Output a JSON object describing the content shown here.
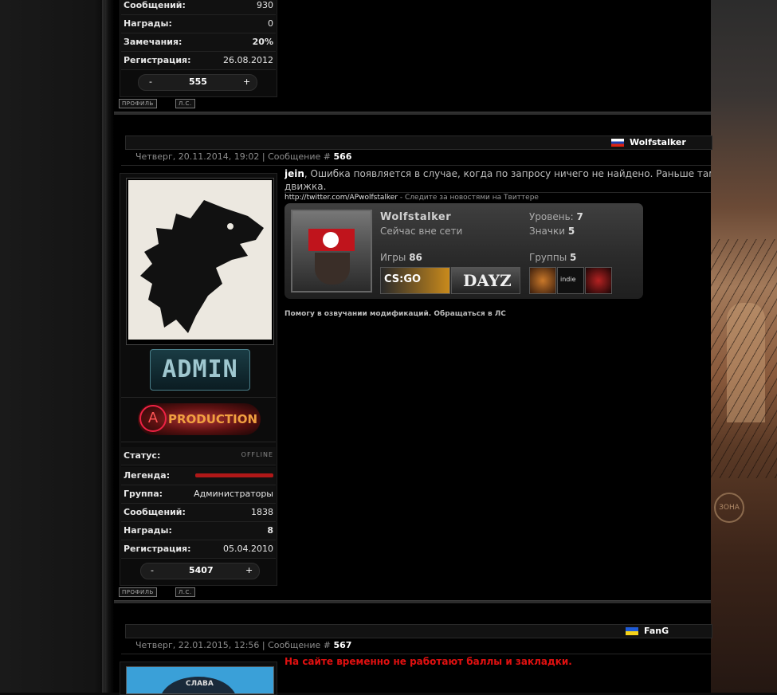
{
  "post_prev": {
    "stats": [
      {
        "label": "Сообщений:",
        "value": "930"
      },
      {
        "label": "Награды:",
        "value": "0"
      },
      {
        "label": "Замечания:",
        "value": "20%"
      },
      {
        "label": "Регистрация:",
        "value": "26.08.2012"
      }
    ],
    "rep": {
      "minus": "-",
      "value": "555",
      "plus": "+"
    },
    "btn_profile": "ПРОФИЛЬ",
    "btn_pm": "Л.С."
  },
  "post_566": {
    "author": "Wolfstalker",
    "date": "Четверг, 20.11.2014, 19:02 | Сообщение #",
    "number": "566",
    "reply_to": "jein",
    "message": ", Ошибка появляется в случае, когда по запросу ничего не найдено. Раньше там пи",
    "message_cont": "движка.",
    "twitter_link": "http://twitter.com/APwolfstalker",
    "twitter_text": " - Следите за новостями на Твиттере",
    "steam": {
      "name": "Wolfstalker",
      "status": "Сейчас вне сети",
      "level_label": "Уровень:",
      "level": "7",
      "badges_label": "Значки",
      "badges": "5",
      "games_label": "Игры",
      "games": "86",
      "groups_label": "Группы",
      "groups": "5",
      "game1": "CS:GO",
      "game2": "DAYZ",
      "group2": "indie"
    },
    "signature": "Помогу в озвучании модификаций. Обращаться в ЛС",
    "rank_badge": "ADMIN",
    "production_badge": "PRODUCTION",
    "stats": [
      {
        "label": "Статус:",
        "value": "OFFLINE"
      },
      {
        "label": "Легенда:",
        "value": ""
      },
      {
        "label": "Группа:",
        "value": "Администраторы"
      },
      {
        "label": "Сообщений:",
        "value": "1838"
      },
      {
        "label": "Награды:",
        "value": "8"
      },
      {
        "label": "Регистрация:",
        "value": "05.04.2010"
      }
    ],
    "rep": {
      "minus": "-",
      "value": "5407",
      "plus": "+"
    },
    "btn_profile": "ПРОФИЛЬ",
    "btn_pm": "Л.С."
  },
  "post_567": {
    "author": "FanG",
    "date": "Четверг, 22.01.2015, 12:56 | Сообщение #",
    "number": "567",
    "message": "На сайте временно не работают баллы и закладки.",
    "avatar_text": "СЛАВА"
  },
  "background": {
    "sign": "ЗОНА"
  },
  "colors": {
    "accent_red": "#e01010",
    "bar_red": "#b01818",
    "steam_panel": "#2b2b2b"
  }
}
